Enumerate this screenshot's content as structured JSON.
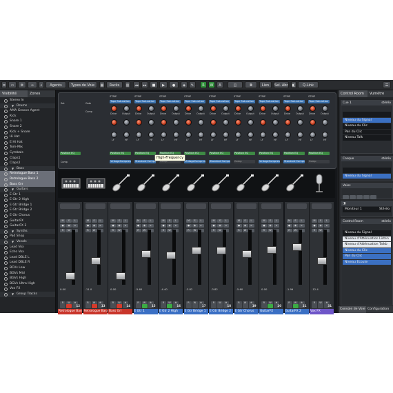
{
  "toolbar": {
    "agents": "Agents",
    "track_types": "Types de Voie",
    "racks": "Racks",
    "lien": "Lien",
    "sel_abr": "Sel. Abr.",
    "qlink": "Q-Link",
    "btn_r": "R",
    "btn_w": "W",
    "btn_a": "A"
  },
  "left_panel": {
    "tab_visibility": "Visibilité",
    "tab_zones": "Zones",
    "items": [
      {
        "label": "Stereo In",
        "type": "item"
      },
      {
        "label": "Drums",
        "type": "group"
      },
      {
        "label": "AMA Groove Agent",
        "type": "item"
      },
      {
        "label": "Kick",
        "type": "item"
      },
      {
        "label": "Snare 1",
        "type": "item"
      },
      {
        "label": "Snare 2",
        "type": "item"
      },
      {
        "label": "Kick + Snare",
        "type": "item"
      },
      {
        "label": "Hi Hat",
        "type": "item"
      },
      {
        "label": "E Hi Hat",
        "type": "item"
      },
      {
        "label": "Tom-Mix",
        "type": "item"
      },
      {
        "label": "Cymbals",
        "type": "item"
      },
      {
        "label": "Claps1",
        "type": "item"
      },
      {
        "label": "Claps2",
        "type": "item"
      },
      {
        "label": "Bass",
        "type": "group"
      },
      {
        "label": "Retrologue Bass 1",
        "type": "sel"
      },
      {
        "label": "Retrologue Bass 2",
        "type": "sel"
      },
      {
        "label": "Bass Grr",
        "type": "sel"
      },
      {
        "label": "Guitars",
        "type": "group"
      },
      {
        "label": "E Gtr 1",
        "type": "item"
      },
      {
        "label": "E Gtr 2 High",
        "type": "item"
      },
      {
        "label": "E Gtr Bridge 1",
        "type": "item"
      },
      {
        "label": "E Gtr Bridge 2",
        "type": "item"
      },
      {
        "label": "E Gtr Chorus",
        "type": "item"
      },
      {
        "label": "GuitarFX",
        "type": "item"
      },
      {
        "label": "GuitarFX 2",
        "type": "item"
      },
      {
        "label": "Synths",
        "type": "group"
      },
      {
        "label": "Pad Shop",
        "type": "item"
      },
      {
        "label": "Vocals",
        "type": "group"
      },
      {
        "label": "Lead Vox",
        "type": "item"
      },
      {
        "label": "Echo Vox",
        "type": "item"
      },
      {
        "label": "Lead DBLE L",
        "type": "item"
      },
      {
        "label": "Lead DBLE R",
        "type": "item"
      },
      {
        "label": "BCVs Low",
        "type": "item"
      },
      {
        "label": "BGVs Mid",
        "type": "item"
      },
      {
        "label": "BGVs High",
        "type": "item"
      },
      {
        "label": "BGVs Ultra High",
        "type": "item"
      },
      {
        "label": "Vox FX",
        "type": "item"
      },
      {
        "label": "Group Tracks",
        "type": "group"
      }
    ]
  },
  "rack": {
    "strip_label": "STRIP",
    "sat": "Sat",
    "gate": "Gate",
    "comp": "Comp",
    "slot_tape": "Tape Saturation",
    "slot_position": "Position EQ",
    "slot_vintage": "VintageCompressor",
    "slot_standard": "Standard Compressor",
    "knob_drive": "Drive",
    "knob_output": "Output",
    "knob_lf": "LF",
    "knob_hf": "HF",
    "tooltip": "High-Frequency"
  },
  "channels": [
    {
      "vol": "0.00",
      "num": "12",
      "name": "Retrologue Bass 1",
      "color": "red",
      "fader": 62,
      "rec": "red"
    },
    {
      "vol": "-11.0",
      "num": "13",
      "name": "Retrologue Bass 2",
      "color": "red",
      "fader": 40,
      "rec": "red"
    },
    {
      "vol": "0.00",
      "num": "14",
      "name": "Bass Grr",
      "color": "red",
      "fader": 62,
      "rec": "red"
    },
    {
      "vol": "-5.60",
      "num": "15",
      "name": "E Gtr 1",
      "color": "blue",
      "fader": 30,
      "rec": "grn"
    },
    {
      "vol": "-4.40",
      "num": "16",
      "name": "E Gtr 2 High",
      "color": "blue",
      "fader": 32,
      "rec": "grn"
    },
    {
      "vol": "-3.82",
      "num": "17",
      "name": "E Gtr Bridge 1",
      "color": "blue",
      "fader": 25,
      "rec": "none"
    },
    {
      "vol": "-3.82",
      "num": "18",
      "name": "E Gtr Bridge 2",
      "color": "blue",
      "fader": 25,
      "rec": "none"
    },
    {
      "vol": "-5.60",
      "num": "19",
      "name": "E Gtr Chorus",
      "color": "blue",
      "fader": 30,
      "rec": "none"
    },
    {
      "vol": "0.00",
      "num": "20",
      "name": "GuitarFX",
      "color": "blue",
      "fader": 24,
      "rec": "grn"
    },
    {
      "vol": "-1.99",
      "num": "21",
      "name": "GuitarFX 2",
      "color": "blue",
      "fader": 20,
      "rec": "grn"
    },
    {
      "vol": "-12.4",
      "num": "31",
      "name": "Vox FX",
      "color": "purple",
      "fader": 40,
      "rec": "none"
    }
  ],
  "right_panel": {
    "tab_control_room": "Control Room",
    "tab_meter": "Vumètre",
    "cue_title": "Cue 1",
    "stereo": "stéréo",
    "cue_signal": "Niveau du Signal",
    "cue_clic": "Niveau du Clic",
    "cue_pan": "Pan du Clic",
    "cue_talk": "Niveau Talk",
    "casque_title": "Casque",
    "casque_signal": "Niveau du Signal",
    "voies_title": "Voies",
    "monitor": "Moniteur 1",
    "stereo2": "Stéréo",
    "cr_title": "Control Room",
    "cr_signal": "Niveau du Signal",
    "cr_att_listen": "Niveau d'Atténuation Listen",
    "cr_att_talk": "Niveau d'Atténuation Talkb",
    "cr_clic": "Niveau du Clic",
    "cr_pan": "Pan du Clic",
    "cr_ecoute": "Niveau Ecoute",
    "bottom_console": "Console de Voie",
    "bottom_config": "Configuration"
  }
}
